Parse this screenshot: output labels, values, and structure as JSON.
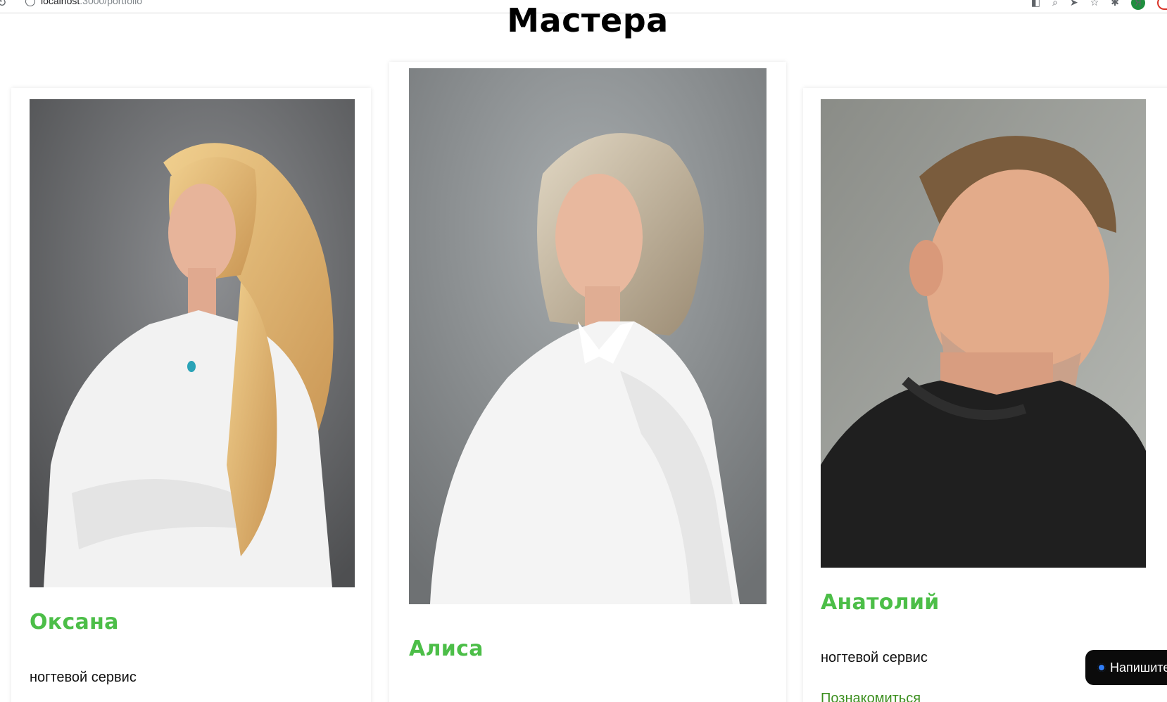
{
  "browser": {
    "url_host": "localhost",
    "url_rest": ":3000/portfolio"
  },
  "page": {
    "title": "Мастера"
  },
  "masters": [
    {
      "name": "Оксана",
      "role": "ногтевой сервис",
      "link": ""
    },
    {
      "name": "Алиса",
      "role": "",
      "link": ""
    },
    {
      "name": "Анатолий",
      "role": "ногтевой сервис",
      "link": "Познакомиться"
    }
  ],
  "chat": {
    "label": "Напишите"
  },
  "colors": {
    "accent_green": "#4cbe48",
    "link_green": "#3c8f1f",
    "chat_bg": "#0b0b0b",
    "chat_dot": "#2f7df6"
  }
}
